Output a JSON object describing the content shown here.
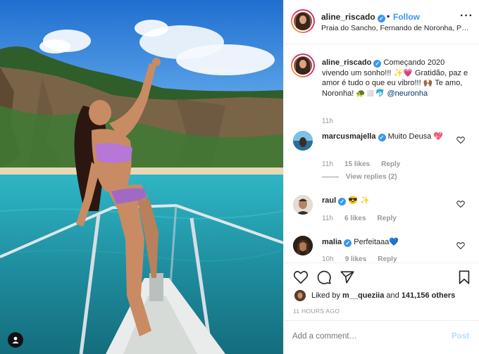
{
  "post": {
    "author": "aline_riscado",
    "follow_label": "Follow",
    "location": "Praia do Sancho, Fernando de Noronha, Pernambuco",
    "caption_text": "Começando 2020 vivendo um sonho!!! ✨💗 Gratidão, paz e amor é tudo o que eu vibro!!! 🙌🏾 Te amo, Noronha! 🐢◻️🐬",
    "caption_mention": "@neuronha",
    "caption_time": "11h"
  },
  "comments": [
    {
      "user": "marcusmajella",
      "text": "Muito Deusa 💖",
      "time": "11h",
      "likes": "15 likes",
      "reply_label": "Reply",
      "view_replies": "View replies (2)"
    },
    {
      "user": "raul",
      "text": "😎 ✨",
      "time": "11h",
      "likes": "6 likes",
      "reply_label": "Reply"
    },
    {
      "user": "malia",
      "text": "Perfeitaaa💙",
      "time": "10h",
      "likes": "9 likes",
      "reply_label": "Reply"
    }
  ],
  "likes": {
    "prefix": "Liked by ",
    "user": "m__queziia",
    "middle": " and ",
    "count": "141,156 others"
  },
  "time_ago": "11 HOURS AGO",
  "add_comment": {
    "placeholder": "Add a comment…",
    "post_label": "Post"
  },
  "icons": {
    "more": "more-options-icon",
    "like": "heart-icon",
    "comment": "comment-bubble-icon",
    "share": "paper-plane-icon",
    "save": "bookmark-icon",
    "tags": "user-tag-icon"
  },
  "colors": {
    "link_blue": "#3897f0",
    "post_disabled": "#b2dffc",
    "meta_gray": "#999999"
  }
}
